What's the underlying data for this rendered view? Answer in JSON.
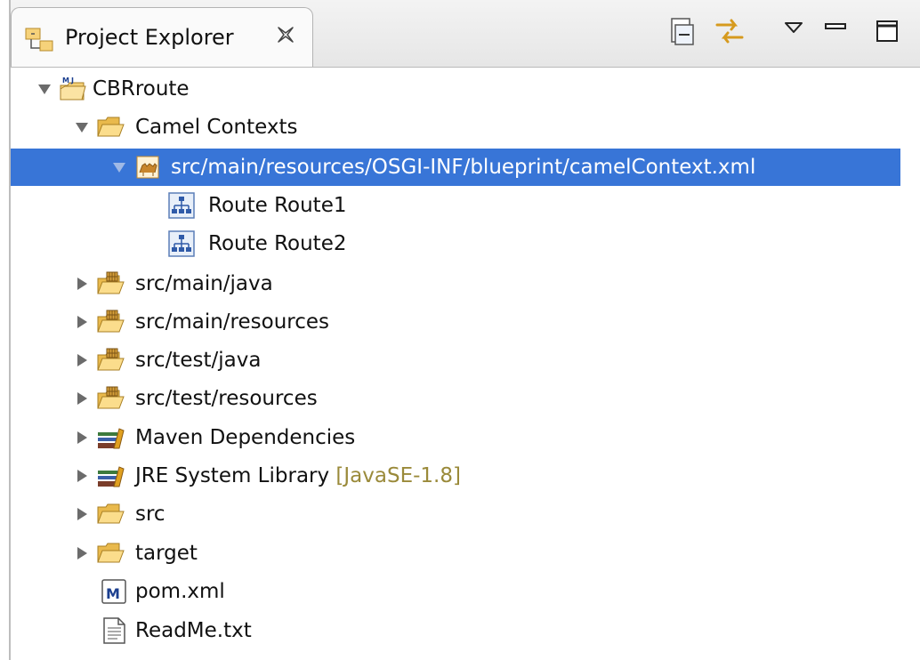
{
  "panel": {
    "title": "Project Explorer",
    "toolbar": [
      {
        "name": "collapse-all",
        "icon": "collapse-all-icon"
      },
      {
        "name": "link-with-editor",
        "icon": "link-arrows-icon"
      },
      {
        "name": "view-menu",
        "icon": "view-menu-icon"
      },
      {
        "name": "minimize",
        "icon": "minimize-icon"
      },
      {
        "name": "maximize",
        "icon": "maximize-icon"
      }
    ]
  },
  "tree": {
    "project": {
      "label": "CBRroute",
      "expanded": true
    },
    "camel_contexts": {
      "label": "Camel Contexts",
      "expanded": true
    },
    "context_file": {
      "label": "src/main/resources/OSGI-INF/blueprint/camelContext.xml",
      "selected": true,
      "expanded": true
    },
    "routes": [
      {
        "label": "Route Route1"
      },
      {
        "label": "Route Route2"
      }
    ],
    "items": [
      {
        "label": "src/main/java",
        "icon": "source-folder-icon"
      },
      {
        "label": "src/main/resources",
        "icon": "source-folder-icon"
      },
      {
        "label": "src/test/java",
        "icon": "source-folder-icon"
      },
      {
        "label": "src/test/resources",
        "icon": "source-folder-icon"
      },
      {
        "label": "Maven Dependencies",
        "icon": "library-icon"
      },
      {
        "label": "JRE System Library",
        "decoration": "[JavaSE-1.8]",
        "icon": "library-icon"
      },
      {
        "label": "src",
        "icon": "folder-icon"
      },
      {
        "label": "target",
        "icon": "folder-icon"
      }
    ],
    "files": [
      {
        "label": "pom.xml",
        "icon": "maven-file-icon"
      },
      {
        "label": "ReadMe.txt",
        "icon": "text-file-icon"
      }
    ]
  },
  "colors": {
    "selection": "#3875d7",
    "decoration": "#9a8a3a",
    "folder": "#f3c35a"
  }
}
